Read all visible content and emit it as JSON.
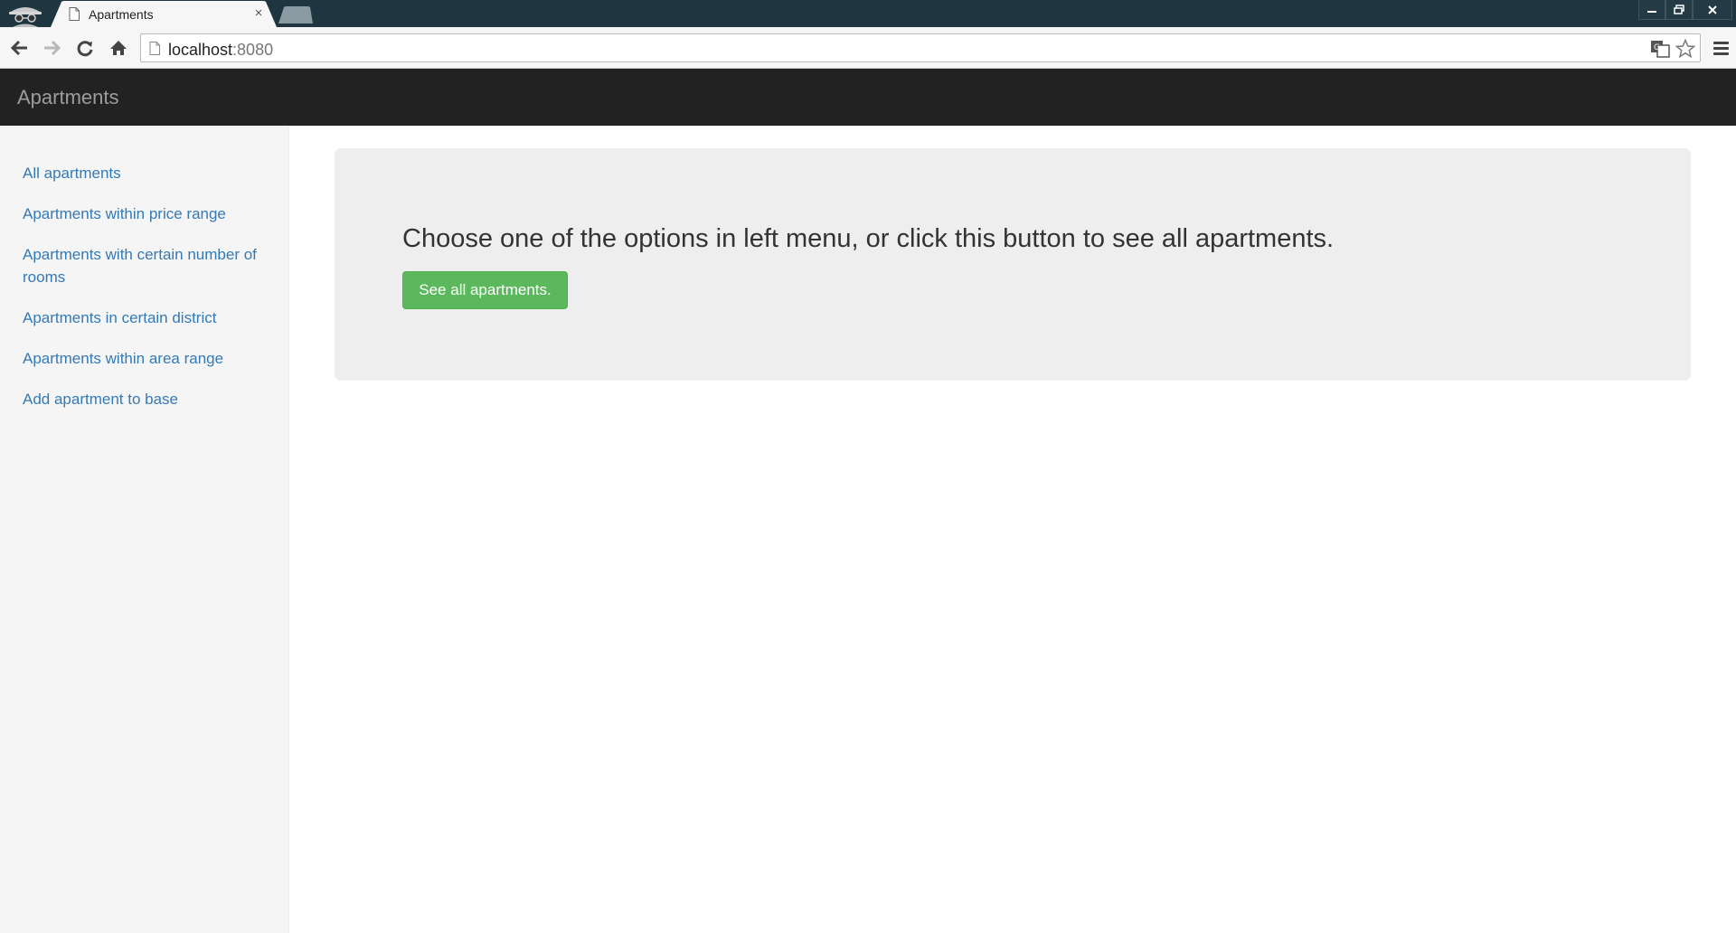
{
  "browser": {
    "tab_title": "Apartments",
    "tab_close": "×",
    "url_host": "localhost",
    "url_port": ":8080",
    "icons": [
      "incognito-icon",
      "page-icon",
      "back-icon",
      "forward-icon",
      "reload-icon",
      "home-icon",
      "translate-icon",
      "star-icon",
      "menu-icon",
      "minimize-icon",
      "restore-icon",
      "close-icon"
    ]
  },
  "navbar": {
    "brand": "Apartments"
  },
  "sidebar": {
    "items": [
      {
        "label": "All apartments"
      },
      {
        "label": "Apartments within price range"
      },
      {
        "label": "Apartments with certain number of rooms"
      },
      {
        "label": "Apartments in certain district"
      },
      {
        "label": "Apartments within area range"
      },
      {
        "label": "Add apartment to base"
      }
    ]
  },
  "main": {
    "lead": "Choose one of the options in left menu, or click this button to see all apartments.",
    "button_label": "See all apartments."
  },
  "colors": {
    "tabstrip": "#1f3540",
    "navbar": "#222222",
    "brand": "#9d9d9d",
    "sidebar_bg": "#f5f5f5",
    "link": "#337ab7",
    "jumbotron_bg": "#eeeeee",
    "success": "#5cb85c"
  }
}
